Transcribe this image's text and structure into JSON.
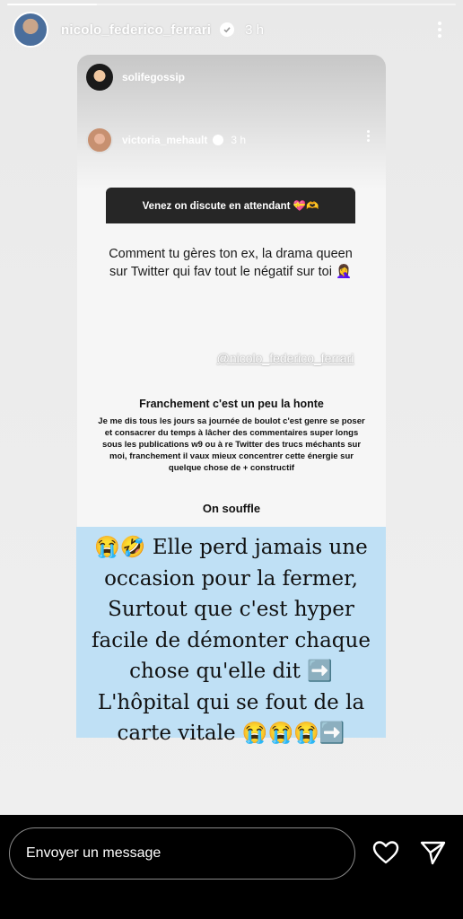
{
  "story": {
    "username": "nicolo_federico_ferrari",
    "time": "3 h",
    "progress": 0.2
  },
  "inner_post": {
    "repost_user": "solifegossip",
    "author": "victoria_mehault",
    "author_time": "3 h",
    "question_prompt": "Venez on discute en attendant 💝🫶",
    "question_text": "Comment tu gères ton ex, la drama queen sur Twitter qui fav tout le négatif sur toi 🤦‍♀️",
    "mention": "@nicolo_federico_ferrari",
    "reply_title": "Franchement c'est un peu la honte",
    "reply_body": "Je me dis tous les jours sa journée de boulot c'est genre se poser et consacrer du temps à lâcher des commentaires super longs sous les publications w9 ou à re Twitter des trucs méchants sur moi, franchement il vaux mieux concentrer cette énergie sur quelque chose de + constructif",
    "reply_end": "On souffle"
  },
  "caption": {
    "lines": [
      "😭🤣 Elle perd jamais une",
      "occasion pour la fermer,",
      "Surtout que c'est hyper",
      "facile de démonter chaque",
      "chose qu'elle dit ➡️",
      "L'hôpital qui se fout de la",
      "carte vitale 😭😭😭➡️"
    ],
    "background": "#bfe0f5"
  },
  "reply_bar": {
    "placeholder": "Envoyer un message"
  },
  "icons": {
    "more": "more-vertical-icon",
    "verified": "verified-badge-icon",
    "like": "heart-icon",
    "send": "send-icon"
  }
}
